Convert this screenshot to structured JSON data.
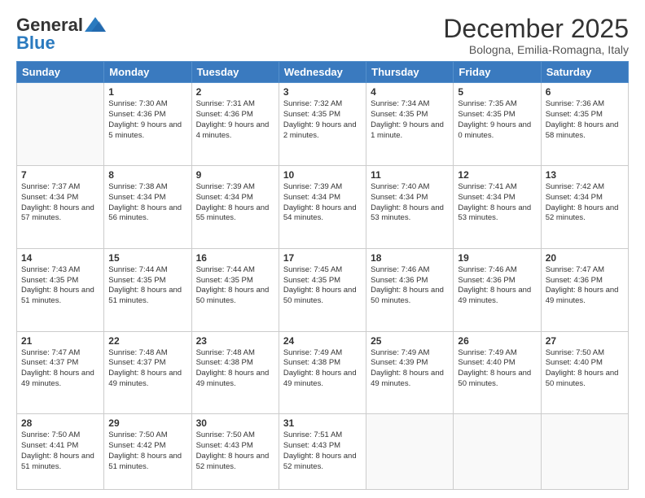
{
  "header": {
    "logo_general": "General",
    "logo_blue": "Blue",
    "month_title": "December 2025",
    "location": "Bologna, Emilia-Romagna, Italy"
  },
  "days_of_week": [
    "Sunday",
    "Monday",
    "Tuesday",
    "Wednesday",
    "Thursday",
    "Friday",
    "Saturday"
  ],
  "weeks": [
    [
      {
        "day": "",
        "sunrise": "",
        "sunset": "",
        "daylight": ""
      },
      {
        "day": "1",
        "sunrise": "Sunrise: 7:30 AM",
        "sunset": "Sunset: 4:36 PM",
        "daylight": "Daylight: 9 hours and 5 minutes."
      },
      {
        "day": "2",
        "sunrise": "Sunrise: 7:31 AM",
        "sunset": "Sunset: 4:36 PM",
        "daylight": "Daylight: 9 hours and 4 minutes."
      },
      {
        "day": "3",
        "sunrise": "Sunrise: 7:32 AM",
        "sunset": "Sunset: 4:35 PM",
        "daylight": "Daylight: 9 hours and 2 minutes."
      },
      {
        "day": "4",
        "sunrise": "Sunrise: 7:34 AM",
        "sunset": "Sunset: 4:35 PM",
        "daylight": "Daylight: 9 hours and 1 minute."
      },
      {
        "day": "5",
        "sunrise": "Sunrise: 7:35 AM",
        "sunset": "Sunset: 4:35 PM",
        "daylight": "Daylight: 9 hours and 0 minutes."
      },
      {
        "day": "6",
        "sunrise": "Sunrise: 7:36 AM",
        "sunset": "Sunset: 4:35 PM",
        "daylight": "Daylight: 8 hours and 58 minutes."
      }
    ],
    [
      {
        "day": "7",
        "sunrise": "Sunrise: 7:37 AM",
        "sunset": "Sunset: 4:34 PM",
        "daylight": "Daylight: 8 hours and 57 minutes."
      },
      {
        "day": "8",
        "sunrise": "Sunrise: 7:38 AM",
        "sunset": "Sunset: 4:34 PM",
        "daylight": "Daylight: 8 hours and 56 minutes."
      },
      {
        "day": "9",
        "sunrise": "Sunrise: 7:39 AM",
        "sunset": "Sunset: 4:34 PM",
        "daylight": "Daylight: 8 hours and 55 minutes."
      },
      {
        "day": "10",
        "sunrise": "Sunrise: 7:39 AM",
        "sunset": "Sunset: 4:34 PM",
        "daylight": "Daylight: 8 hours and 54 minutes."
      },
      {
        "day": "11",
        "sunrise": "Sunrise: 7:40 AM",
        "sunset": "Sunset: 4:34 PM",
        "daylight": "Daylight: 8 hours and 53 minutes."
      },
      {
        "day": "12",
        "sunrise": "Sunrise: 7:41 AM",
        "sunset": "Sunset: 4:34 PM",
        "daylight": "Daylight: 8 hours and 53 minutes."
      },
      {
        "day": "13",
        "sunrise": "Sunrise: 7:42 AM",
        "sunset": "Sunset: 4:34 PM",
        "daylight": "Daylight: 8 hours and 52 minutes."
      }
    ],
    [
      {
        "day": "14",
        "sunrise": "Sunrise: 7:43 AM",
        "sunset": "Sunset: 4:35 PM",
        "daylight": "Daylight: 8 hours and 51 minutes."
      },
      {
        "day": "15",
        "sunrise": "Sunrise: 7:44 AM",
        "sunset": "Sunset: 4:35 PM",
        "daylight": "Daylight: 8 hours and 51 minutes."
      },
      {
        "day": "16",
        "sunrise": "Sunrise: 7:44 AM",
        "sunset": "Sunset: 4:35 PM",
        "daylight": "Daylight: 8 hours and 50 minutes."
      },
      {
        "day": "17",
        "sunrise": "Sunrise: 7:45 AM",
        "sunset": "Sunset: 4:35 PM",
        "daylight": "Daylight: 8 hours and 50 minutes."
      },
      {
        "day": "18",
        "sunrise": "Sunrise: 7:46 AM",
        "sunset": "Sunset: 4:36 PM",
        "daylight": "Daylight: 8 hours and 50 minutes."
      },
      {
        "day": "19",
        "sunrise": "Sunrise: 7:46 AM",
        "sunset": "Sunset: 4:36 PM",
        "daylight": "Daylight: 8 hours and 49 minutes."
      },
      {
        "day": "20",
        "sunrise": "Sunrise: 7:47 AM",
        "sunset": "Sunset: 4:36 PM",
        "daylight": "Daylight: 8 hours and 49 minutes."
      }
    ],
    [
      {
        "day": "21",
        "sunrise": "Sunrise: 7:47 AM",
        "sunset": "Sunset: 4:37 PM",
        "daylight": "Daylight: 8 hours and 49 minutes."
      },
      {
        "day": "22",
        "sunrise": "Sunrise: 7:48 AM",
        "sunset": "Sunset: 4:37 PM",
        "daylight": "Daylight: 8 hours and 49 minutes."
      },
      {
        "day": "23",
        "sunrise": "Sunrise: 7:48 AM",
        "sunset": "Sunset: 4:38 PM",
        "daylight": "Daylight: 8 hours and 49 minutes."
      },
      {
        "day": "24",
        "sunrise": "Sunrise: 7:49 AM",
        "sunset": "Sunset: 4:38 PM",
        "daylight": "Daylight: 8 hours and 49 minutes."
      },
      {
        "day": "25",
        "sunrise": "Sunrise: 7:49 AM",
        "sunset": "Sunset: 4:39 PM",
        "daylight": "Daylight: 8 hours and 49 minutes."
      },
      {
        "day": "26",
        "sunrise": "Sunrise: 7:49 AM",
        "sunset": "Sunset: 4:40 PM",
        "daylight": "Daylight: 8 hours and 50 minutes."
      },
      {
        "day": "27",
        "sunrise": "Sunrise: 7:50 AM",
        "sunset": "Sunset: 4:40 PM",
        "daylight": "Daylight: 8 hours and 50 minutes."
      }
    ],
    [
      {
        "day": "28",
        "sunrise": "Sunrise: 7:50 AM",
        "sunset": "Sunset: 4:41 PM",
        "daylight": "Daylight: 8 hours and 51 minutes."
      },
      {
        "day": "29",
        "sunrise": "Sunrise: 7:50 AM",
        "sunset": "Sunset: 4:42 PM",
        "daylight": "Daylight: 8 hours and 51 minutes."
      },
      {
        "day": "30",
        "sunrise": "Sunrise: 7:50 AM",
        "sunset": "Sunset: 4:43 PM",
        "daylight": "Daylight: 8 hours and 52 minutes."
      },
      {
        "day": "31",
        "sunrise": "Sunrise: 7:51 AM",
        "sunset": "Sunset: 4:43 PM",
        "daylight": "Daylight: 8 hours and 52 minutes."
      },
      {
        "day": "",
        "sunrise": "",
        "sunset": "",
        "daylight": ""
      },
      {
        "day": "",
        "sunrise": "",
        "sunset": "",
        "daylight": ""
      },
      {
        "day": "",
        "sunrise": "",
        "sunset": "",
        "daylight": ""
      }
    ]
  ]
}
